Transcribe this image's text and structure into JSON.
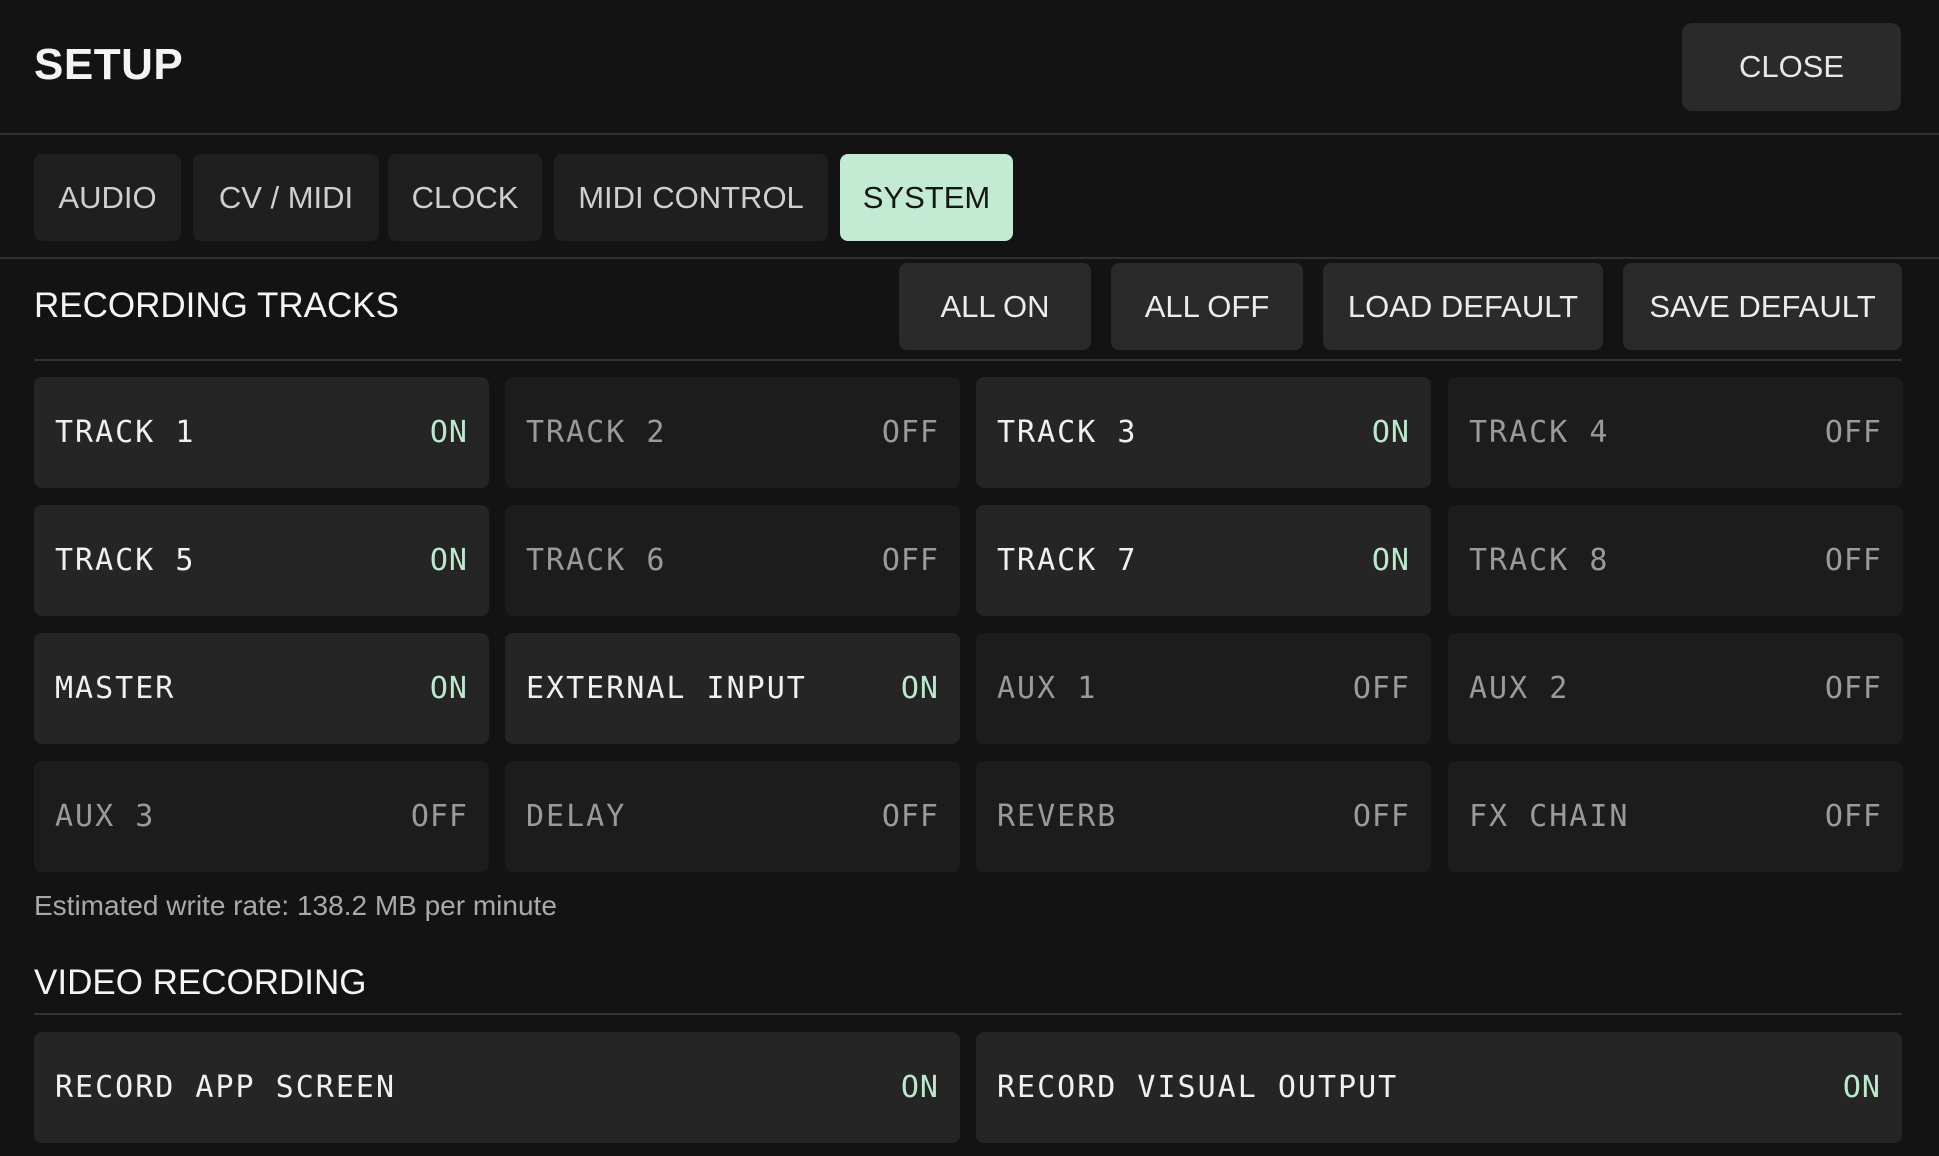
{
  "header": {
    "title": "SETUP",
    "close_label": "CLOSE"
  },
  "tabs": [
    {
      "label": "AUDIO",
      "active": false
    },
    {
      "label": "CV / MIDI",
      "active": false
    },
    {
      "label": "CLOCK",
      "active": false
    },
    {
      "label": "MIDI CONTROL",
      "active": false
    },
    {
      "label": "SYSTEM",
      "active": true
    }
  ],
  "recording": {
    "title": "RECORDING TRACKS",
    "actions": {
      "all_on": "ALL ON",
      "all_off": "ALL OFF",
      "load_default": "LOAD DEFAULT",
      "save_default": "SAVE DEFAULT"
    },
    "tracks": [
      {
        "label": "TRACK 1",
        "state": "ON"
      },
      {
        "label": "TRACK 2",
        "state": "OFF"
      },
      {
        "label": "TRACK 3",
        "state": "ON"
      },
      {
        "label": "TRACK 4",
        "state": "OFF"
      },
      {
        "label": "TRACK 5",
        "state": "ON"
      },
      {
        "label": "TRACK 6",
        "state": "OFF"
      },
      {
        "label": "TRACK 7",
        "state": "ON"
      },
      {
        "label": "TRACK 8",
        "state": "OFF"
      },
      {
        "label": "MASTER",
        "state": "ON"
      },
      {
        "label": "EXTERNAL INPUT",
        "state": "ON"
      },
      {
        "label": "AUX 1",
        "state": "OFF"
      },
      {
        "label": "AUX 2",
        "state": "OFF"
      },
      {
        "label": "AUX 3",
        "state": "OFF"
      },
      {
        "label": "DELAY",
        "state": "OFF"
      },
      {
        "label": "REVERB",
        "state": "OFF"
      },
      {
        "label": "FX CHAIN",
        "state": "OFF"
      }
    ],
    "write_rate": "Estimated write rate: 138.2 MB per minute"
  },
  "video": {
    "title": "VIDEO RECORDING",
    "items": [
      {
        "label": "RECORD APP SCREEN",
        "state": "ON"
      },
      {
        "label": "RECORD VISUAL OUTPUT",
        "state": "ON"
      }
    ]
  },
  "colors": {
    "accent": "#c3ead2",
    "on_text": "#bde8cc",
    "background": "#131313"
  }
}
